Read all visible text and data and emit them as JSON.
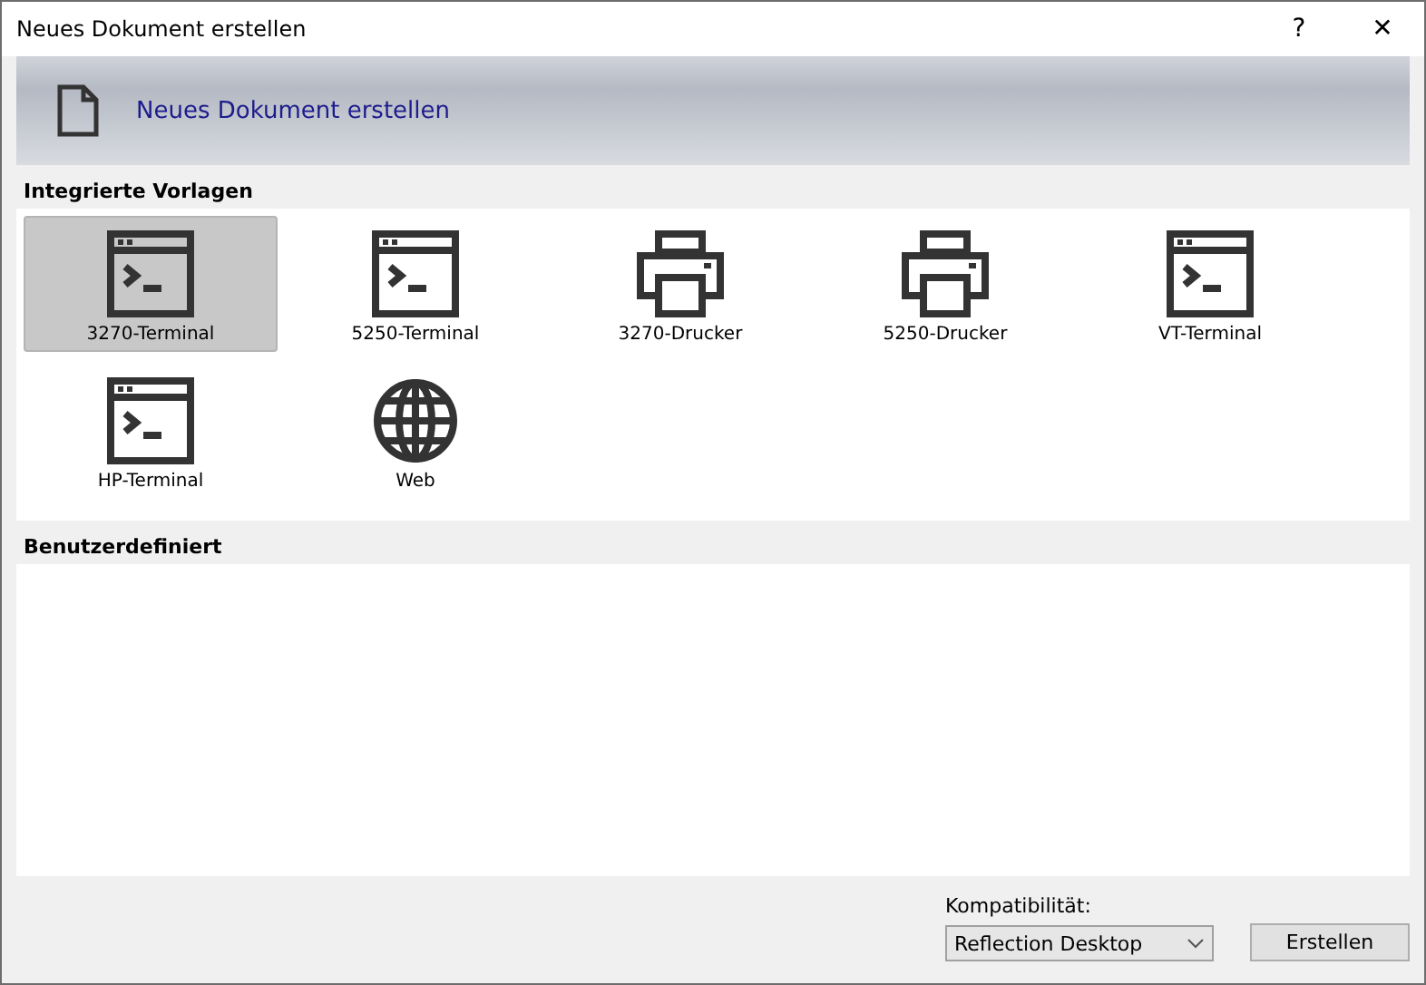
{
  "window": {
    "title": "Neues Dokument erstellen",
    "help": "?",
    "close": "✕"
  },
  "header": {
    "title": "Neues Dokument erstellen"
  },
  "builtin": {
    "title": "Integrierte Vorlagen",
    "items": [
      {
        "label": "3270-Terminal",
        "kind": "terminal",
        "selected": true
      },
      {
        "label": "5250-Terminal",
        "kind": "terminal",
        "selected": false
      },
      {
        "label": "3270-Drucker",
        "kind": "printer",
        "selected": false
      },
      {
        "label": "5250-Drucker",
        "kind": "printer",
        "selected": false
      },
      {
        "label": "VT-Terminal",
        "kind": "terminal",
        "selected": false
      },
      {
        "label": "HP-Terminal",
        "kind": "terminal",
        "selected": false
      },
      {
        "label": "Web",
        "kind": "web",
        "selected": false
      }
    ]
  },
  "custom": {
    "title": "Benutzerdefiniert"
  },
  "compatibility": {
    "label": "Kompatibilität:",
    "value": "Reflection Desktop"
  },
  "buttons": [
    {
      "label": "Erstellen"
    }
  ]
}
